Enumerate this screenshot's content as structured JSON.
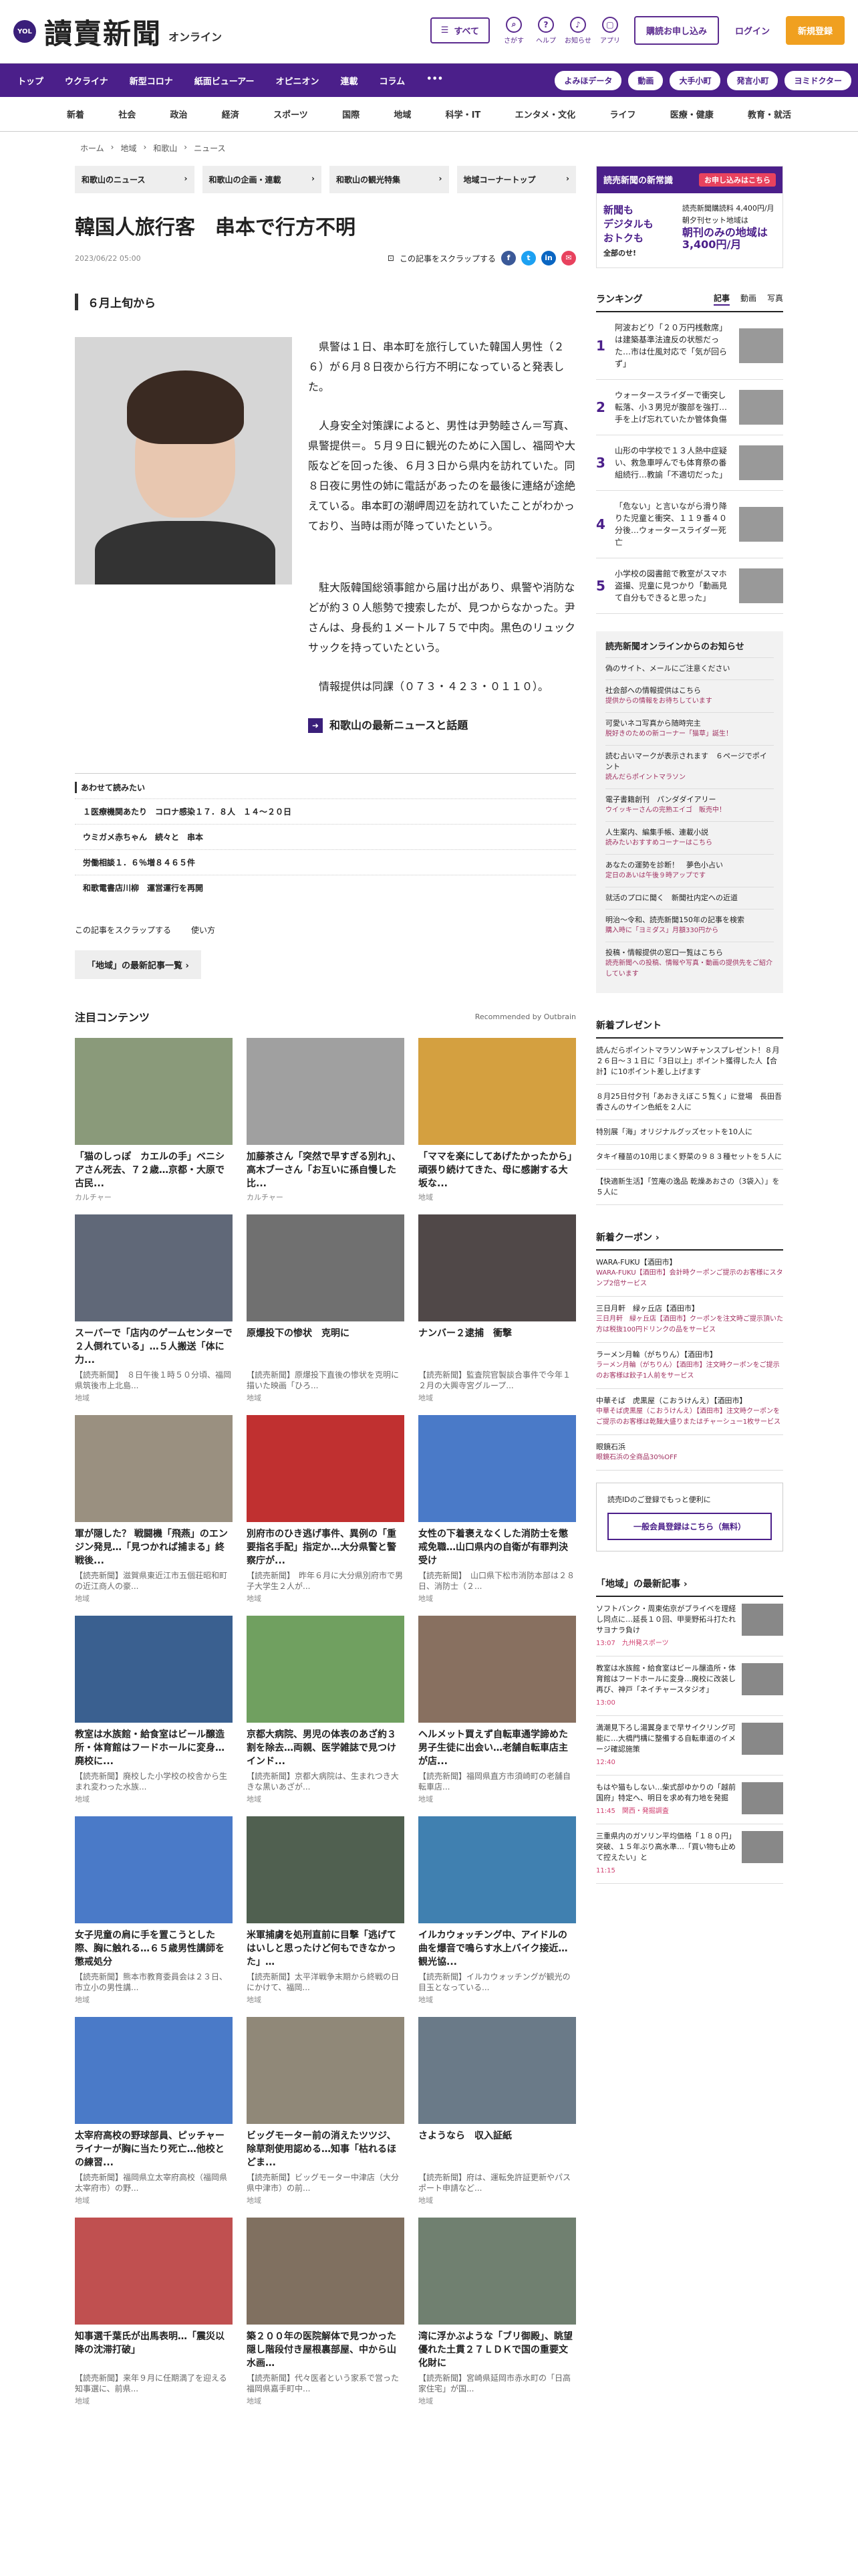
{
  "header": {
    "logo_badge": "YOL",
    "logo": "讀賣新聞",
    "logo_sub": "オンライン",
    "menu_label": "すべて",
    "icons": [
      {
        "name": "search-icon",
        "label": "さがす",
        "glyph": "⌕"
      },
      {
        "name": "help-icon",
        "label": "ヘルプ",
        "glyph": "?"
      },
      {
        "name": "bell-icon",
        "label": "お知らせ",
        "glyph": "♪"
      },
      {
        "name": "app-icon",
        "label": "アプリ",
        "glyph": "▢"
      }
    ],
    "subscribe_label": "購読お申し込み",
    "login_label": "ログイン",
    "register_label": "新規登録"
  },
  "primary_nav": {
    "items": [
      "トップ",
      "ウクライナ",
      "新型コロナ",
      "紙面ビューアー",
      "オピニオン",
      "連載",
      "コラム",
      "•••"
    ],
    "pills": [
      "よみほデータ",
      "動画",
      "大手小町",
      "発言小町",
      "ヨミドクター"
    ]
  },
  "secondary_nav": [
    "新着",
    "社会",
    "政治",
    "経済",
    "スポーツ",
    "国際",
    "地域",
    "科学・IT",
    "エンタメ・文化",
    "ライフ",
    "医療・健康",
    "教育・就活"
  ],
  "breadcrumb": [
    "ホーム",
    "地域",
    "和歌山",
    "ニュース"
  ],
  "cat_tabs": [
    "和歌山のニュース",
    "和歌山の企画・連載",
    "和歌山の観光特集",
    "地域コーナートップ"
  ],
  "article": {
    "title": "韓国人旅行客　串本で行方不明",
    "date": "2023/06/22 05:00",
    "scrap_label": "この記事をスクラップする",
    "subheading": "６月上旬から",
    "paragraphs": [
      "県警は１日、串本町を旅行していた韓国人男性（２６）が６月８日夜から行方不明になっていると発表した。",
      "人身安全対策課によると、男性は尹勢睦さん＝写真、県警提供＝。５月９日に観光のために入国し、福岡や大阪などを回った後、６月３日から県内を訪れていた。同８日夜に男性の姉に電話があったのを最後に連絡が途絶えている。串本町の潮岬周辺を訪れていたことがわかっており、当時は雨が降っていたという。",
      "駐大阪韓国総領事館から届け出があり、県警や消防などが約３０人態勢で捜索したが、見つからなかった。尹さんは、身長約１メートル７５で中肉。黒色のリュックサックを持っていたという。",
      "情報提供は同課（０７３・４２３・０１１０）。"
    ],
    "more_link": "和歌山の最新ニュースと話題"
  },
  "related": {
    "heading": "あわせて読みたい",
    "items": [
      "１医療機関あたり　コロナ感染１７．８人　１４〜２０日",
      "ウミガメ赤ちゃん　続々と　串本",
      "労働相談１．６％増８４６５件",
      "和歌電書店川柳　運営運行を再開"
    ]
  },
  "scrap2": [
    "この記事をスクラップする",
    "使い方"
  ],
  "region_btn": "「地域」の最新記事一覧 ›",
  "focus": {
    "title": "注目コンテンツ",
    "outbrain": "Recommended by Outbrain",
    "cards": [
      {
        "title": "「猫のしっぽ　カエルの手」ベニシアさん死去、７２歳…京都・大原で古民...",
        "src": "カルチャー",
        "color": "#8a9a7a"
      },
      {
        "title": "加藤茶さん「突然で早すぎる別れ」、高木ブーさん「お互いに孫自慢した比...",
        "src": "カルチャー",
        "color": "#a0a0a0"
      },
      {
        "title": "「ママを楽にしてあげたかったから」頑張り続けてきた、母に感謝する大坂な...",
        "src": "地域",
        "color": "#d4a040"
      },
      {
        "title": "スーパーで「店内のゲームセンターで２人倒れている」…５人搬送「体に力...",
        "desc": "【読売新聞】　８日午後１時５０分頃、福岡県筑後市上北島...",
        "src": "地域",
        "color": "#606878"
      },
      {
        "title": "原爆投下の惨状　克明に",
        "desc": "【読売新聞】原爆投下直後の惨状を克明に描いた映画「ひろ...",
        "src": "地域",
        "color": "#707070"
      },
      {
        "title": "ナンバー２逮捕　衝撃",
        "desc": "【読売新聞】監査院官製談合事件で今年１２月の大興寺宮グループ...",
        "src": "地域",
        "color": "#504848"
      },
      {
        "title": "軍が隠した？ 戦闘機「飛燕」のエンジン発見…「見つかれば捕まる」終戦後...",
        "desc": "【読売新聞】滋賀県東近江市五個荘昭和町の近江商人の豪...",
        "src": "地域",
        "color": "#9a9080"
      },
      {
        "title": "別府市のひき逃げ事件、異例の「重要指名手配」指定か…大分県警と警察庁が...",
        "desc": "【読売新聞】　昨年６月に大分県別府市で男子大学生２人が...",
        "src": "地域",
        "color": "#c03030"
      },
      {
        "title": "女性の下着褒えなくした消防士を懲戒免職…山口県内の自衛が有罪判決受け",
        "desc": "【読売新聞】　山口県下松市消防本部は２８日、消防士（２...",
        "src": "地域",
        "color": "#4a7ac8"
      },
      {
        "title": "教室は水族館・給食室はビール醸造所・体育館はフードホールに変身…廃校に...",
        "desc": "【読売新聞】廃校した小学校の校舎から生まれ変わった水族...",
        "src": "地域",
        "color": "#3a6090"
      },
      {
        "title": "京都大病院、男児の体表のあざ約３割を除去…両親、医学雑誌で見つけインド...",
        "desc": "【読売新聞】京都大病院は、生まれつき大きな黒いあざが...",
        "src": "地域",
        "color": "#70a060"
      },
      {
        "title": "ヘルメット買えず自転車通学諦めた男子生徒に出会い…老舗自転車店主が店...",
        "desc": "【読売新聞】福岡県直方市須崎町の老舗自転車店...",
        "src": "地域",
        "color": "#887060"
      },
      {
        "title": "女子児童の肩に手を置こうとした際、胸に触れる…６５歳男性講師を懲戒処分",
        "desc": "【読売新聞】熊本市教育委員会は２３日、市立小の男性講...",
        "src": "地域",
        "color": "#4a7ac8"
      },
      {
        "title": "米軍捕虜を処刑直前に目撃「逃げてはいしと思ったけど何もできなかった」…",
        "desc": "【読売新聞】太平洋戦争末期から終戦の日にかけて、福岡...",
        "src": "地域",
        "color": "#506050"
      },
      {
        "title": "イルカウォッチング中、アイドルの曲を爆音で鳴らす水上バイク接近…観光協...",
        "desc": "【読売新聞】イルカウォッチングが観光の目玉となっている...",
        "src": "地域",
        "color": "#4080b0"
      },
      {
        "title": "太宰府高校の野球部員、ピッチャーライナーが胸に当たり死亡…他校との練習...",
        "desc": "【読売新聞】福岡県立太宰府高校（福岡県太宰府市）の野...",
        "src": "地域",
        "color": "#4a7ac8"
      },
      {
        "title": "ビッグモーター前の消えたツツジ、除草剤使用認める…知事「枯れるほどま...",
        "desc": "【読売新聞】ビッグモーター中津店（大分県中津市）の前...",
        "src": "地域",
        "color": "#908878"
      },
      {
        "title": "さようなら　収入証紙",
        "desc": "【読売新聞】府は、運転免許証更新やパスポート申請など...",
        "src": "地域",
        "color": "#6a7a88"
      },
      {
        "title": "知事選千葉氏が出馬表明…「震災以降の沈滞打破」",
        "desc": "【読売新聞】来年９月に任期満了を迎える知事選に、前県...",
        "src": "地域",
        "color": "#c05050"
      },
      {
        "title": "築２００年の医院解体で見つかった隠し階段付き屋根裏部屋、中から山水画…",
        "desc": "【読売新聞】代々医者という家系で営った福岡県嘉手町中...",
        "src": "地域",
        "color": "#807060"
      },
      {
        "title": "湾に浮かぶような「ブリ御殿」、眺望優れた土貫２７ＬＤＫで国の重要文化財に",
        "desc": "【読売新聞】宮崎県延岡市赤水町の「日高家住宅」が国...",
        "src": "地域",
        "color": "#708070"
      }
    ]
  },
  "sidebar": {
    "promo": {
      "heading": "読売新聞の新常識",
      "cta": "お申し込みはこちら",
      "col1": [
        "新聞も",
        "デジタルも",
        "おトクも"
      ],
      "col1_foot": "全部のせ!",
      "col2_lines": [
        "読売新聞購読料 4,400円/月",
        "朝夕刊セット地域は",
        "朝刊のみの地域は 3,400円/月"
      ]
    },
    "ranking": {
      "title": "ランキング",
      "tabs": [
        "記事",
        "動画",
        "写真"
      ],
      "items": [
        "阿波おどり「２０万円桟敷席」は建築基準法違反の状態だった…市は仕風対応で「気が回らず」",
        "ウォータースライダーで衝突し転落、小３男児が腹部を強打…手を上げ忘れていたか管体負傷",
        "山形の中学校で１３人熱中症疑い、救急車呼んでも体育祭の番組続行…教諭「不適切だった」",
        "「危ない」と言いながら滑り降りた児童と衝突、１１９番４０分後…ウォータースライダー死亡",
        "小学校の図書館で教室がスマホ盗撮、児童に見つかり「動画見て自分もできると思った」"
      ]
    },
    "notice": {
      "title": "読売新聞オンラインからのお知らせ",
      "items": [
        {
          "text": "偽のサイト、メールにご注意ください",
          "hi": ""
        },
        {
          "text": "社会部への情報提供はこちら",
          "hi": "提供からの情報をお待ちしています"
        },
        {
          "text": "可愛いネコ写真から随時完主",
          "hi": "脱好きのための新コーナー「猫草」誕生！"
        },
        {
          "text": "読む占いマークが表示されます　６ページでポイント",
          "hi": "読んだらポイントマラソン"
        },
        {
          "text": "電子書籍創刊　パンダダイアリー",
          "hi": "ウイッキーさんの完熟エイゴ　販売中！"
        },
        {
          "text": "人生案内、編集手帳、連載小説",
          "hi": "読みたいおすすめコーナーはこちら"
        },
        {
          "text": "あなたの運勢を診断！　夢色小占い",
          "hi": "定日のあいは午後９時アップです"
        },
        {
          "text": "就活のプロに聞く　新聞社内定への近道",
          "hi": ""
        },
        {
          "text": "明治〜令和、読売新聞150年の記事を検索",
          "hi": "購入時に「ヨミダス」月額330円から"
        },
        {
          "text": "投稿・情報提供の窓口一覧はこちら",
          "hi": "読売新聞への投稿、情報や写真・動画の提供先をご紹介しています"
        }
      ]
    },
    "present": {
      "title": "新着プレゼント",
      "items": [
        "読んだらポイントマラソンWチャンスプレゼント！８月２６日〜３１日に「3日以上」ポイント獲得した人【合計】に10ポイント差し上げます",
        "８月25日付夕刊「あおきえぼこ５覧く」に登場　長田吾香さんのサイン色紙を２人に",
        "特別展「海」オリジナルグッズセットを10人に",
        "タキイ種苗の10用じまく野菜の９８３種セットを５人に",
        "【快適新生活】「笠庵の逸品 乾燥あおさの（3袋入）」を５人に"
      ]
    },
    "coupon": {
      "title": "新着クーポン ›",
      "items": [
        {
          "text": "WARA-FUKU【酒田市】",
          "hi": "WARA-FUKU【酒田市】会計時クーポンご提示のお客様にスタンプ2倍サービス"
        },
        {
          "text": "三日月軒　緑ヶ丘店【酒田市】",
          "hi": "三日月軒　緑ヶ丘店【酒田市】クーポンを注文時ご提示頂いた方は税抜100円ドリンクの品をサービス"
        },
        {
          "text": "ラーメン月輪（がちりん）【酒田市】",
          "hi": "ラーメン月輪（がちりん）【酒田市】注文時クーポンをご提示のお客様は餃子1人前をサービス"
        },
        {
          "text": "中華そば　虎黒屋（こおうけんえ）【酒田市】",
          "hi": "中華そば虎黒屋（こおうけんえ）【酒田市】注文時クーポンをご提示のお客様は乾麺大盛りまたはチャーシュー1枚サービス"
        },
        {
          "text": "眼鏡石浜",
          "hi": "眼鏡石浜の全商品30%OFF"
        }
      ]
    },
    "reg": {
      "text": "読売IDのご登録でもっと便利に",
      "button": "一般会員登録はこちら（無料）"
    },
    "local": {
      "title": "「地域」の最新記事 ›",
      "items": [
        {
          "text": "ソフトバンク・周東佑京がブライベを理経し同点に…延長１０回、甲斐野拓斗打たれサヨナラ負け",
          "time": "13:07",
          "tag": "九州発スポーツ"
        },
        {
          "text": "教室は水族館・給食室はビール醸造所・体育館はフードホールに変身…廃校に改装し再び、神戸「ネイチャースタジオ」",
          "time": "13:00",
          "tag": ""
        },
        {
          "text": "満潮見下ろし湯翼身まで早サイクリング可能に…大橋門構に整備する自転車道のイメージ確認施策",
          "time": "12:40",
          "tag": ""
        },
        {
          "text": "もはや猫もしない…柴式部ゆかりの「越前国府」特定へ、明日を求め有力地を発掘",
          "time": "11:45",
          "tag": "関西・発掘調査"
        },
        {
          "text": "三重県内のガソリン平均価格「１８０円」突破、１５年ぶり高水準…「買い物も止めて控えたい」と",
          "time": "11:15",
          "tag": ""
        }
      ]
    }
  }
}
